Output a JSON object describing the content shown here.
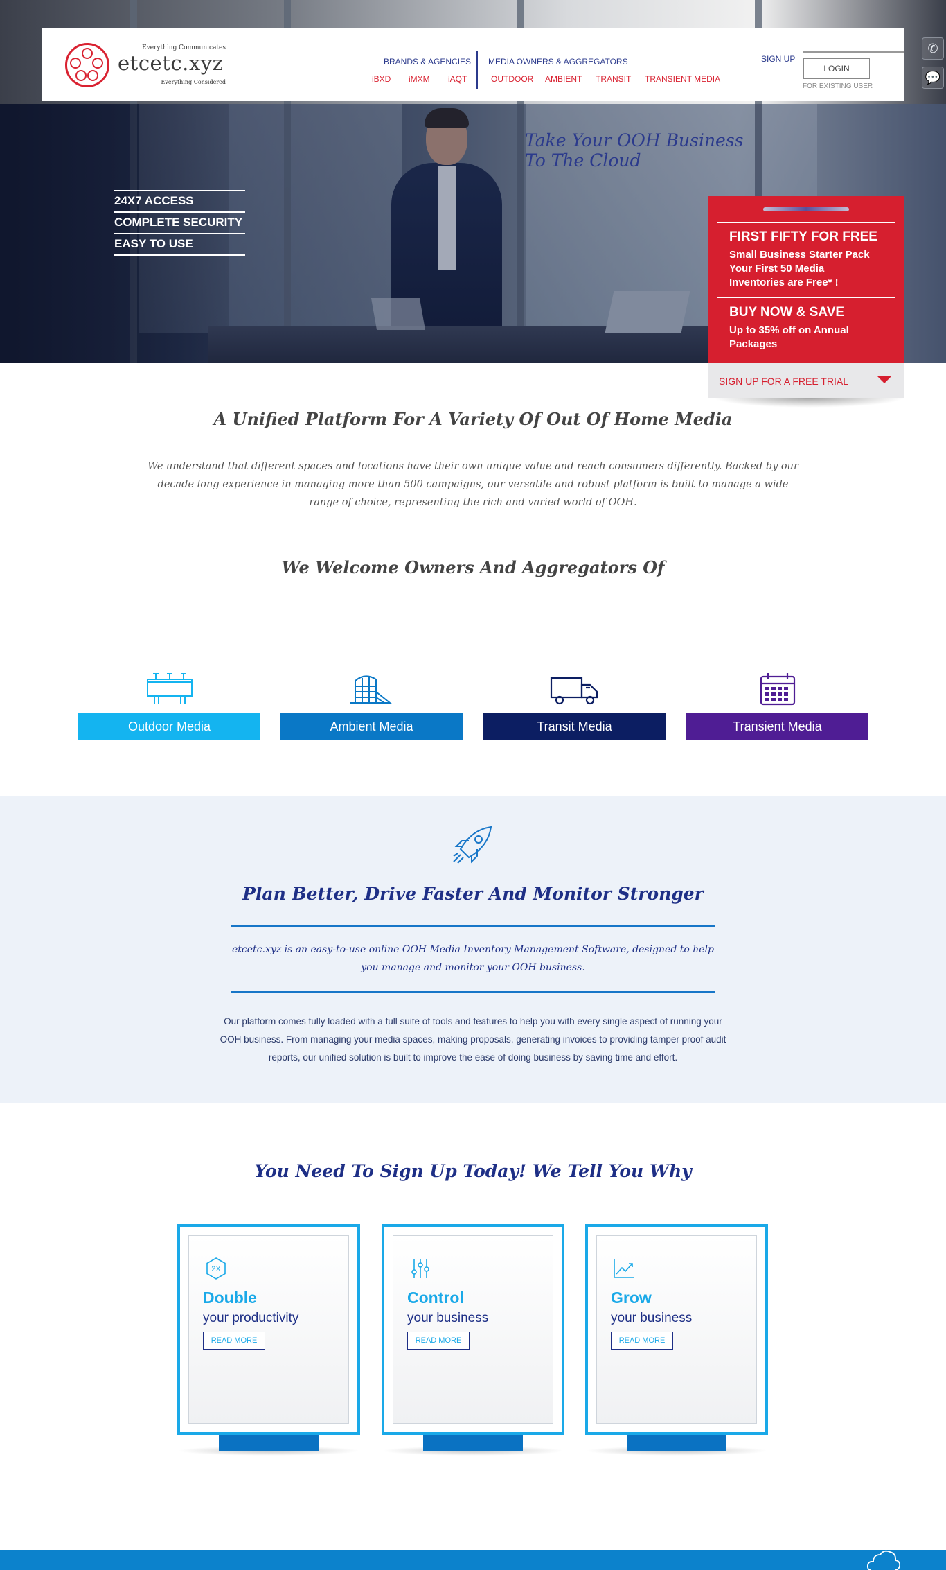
{
  "brand": {
    "tagline_top": "Everything Communicates",
    "name": "etcetc.xyz",
    "tagline_bottom": "Everything Considered",
    "color": "#d92231"
  },
  "nav": {
    "brands_title": "BRANDS & AGENCIES",
    "brands_links": [
      "iBXD",
      "iMXM",
      "iAQT"
    ],
    "owners_title": "MEDIA OWNERS & AGGREGATORS",
    "owners_links": [
      "OUTDOOR",
      "AMBIENT",
      "TRANSIT",
      "TRANSIENT MEDIA"
    ]
  },
  "account": {
    "signup": "SIGN UP",
    "login": "LOGIN",
    "login_sub": "FOR EXISTING USER"
  },
  "side_icons": [
    "phone-icon",
    "chat-icon"
  ],
  "hero": {
    "features": [
      "24X7 ACCESS",
      "COMPLETE SECURITY",
      "EASY TO USE"
    ],
    "tagline_line1": "Take Your OOH Business",
    "tagline_line2": "To The Cloud"
  },
  "promo": {
    "offer1_title": "FIRST FIFTY FOR FREE",
    "offer1_text": [
      "Small Business Starter Pack",
      "Your First 50 Media",
      "Inventories are Free* !"
    ],
    "offer2_title": "BUY NOW & SAVE",
    "offer2_text": [
      "Up to 35% off on Annual",
      "Packages"
    ],
    "cta": "SIGN UP FOR A FREE TRIAL",
    "color": "#d61f2f"
  },
  "intro": {
    "title": "A Unified Platform For A Variety Of Out Of Home Media",
    "text": "We understand that different spaces and locations have their own unique value and reach consumers differently. Backed by our decade long experience in managing more than 500 campaigns, our versatile and robust platform is built to manage a wide range of choice, representing the rich and varied world of OOH.",
    "welcome": "We Welcome Owners And Aggregators Of"
  },
  "media": [
    {
      "label": "Outdoor Media",
      "icon": "billboard-icon",
      "color": "#14b4f0"
    },
    {
      "label": "Ambient Media",
      "icon": "building-icon",
      "color": "#0a78c6"
    },
    {
      "label": "Transit Media",
      "icon": "truck-icon",
      "color": "#0c1e62"
    },
    {
      "label": "Transient Media",
      "icon": "calendar-icon",
      "color": "#4f1d94"
    }
  ],
  "plan": {
    "icon": "rocket-icon",
    "title": "Plan Better, Drive Faster And Monitor Stronger",
    "quote": "etcetc.xyz is an easy-to-use online OOH Media Inventory Management Software, designed to help you manage and monitor your OOH business.",
    "body": "Our platform comes fully loaded with a full suite of tools and features to help you with every single aspect of running your OOH business. From managing your media spaces, making proposals, generating invoices to providing tamper proof audit reports, our unified solution is built to improve the ease of doing business by saving time and effort."
  },
  "why": {
    "title": "You Need To Sign Up Today! We Tell You Why",
    "cards": [
      {
        "icon": "2x-hexagon-icon",
        "icon_text": "2X",
        "head": "Double",
        "sub": "your productivity",
        "button": "READ MORE"
      },
      {
        "icon": "sliders-icon",
        "head": "Control",
        "sub": "your business",
        "button": "READ MORE"
      },
      {
        "icon": "growth-chart-icon",
        "head": "Grow",
        "sub": "your business",
        "button": "READ MORE"
      }
    ]
  },
  "footer": {
    "icon": "cloud-icon",
    "color": "#0c82cc"
  }
}
